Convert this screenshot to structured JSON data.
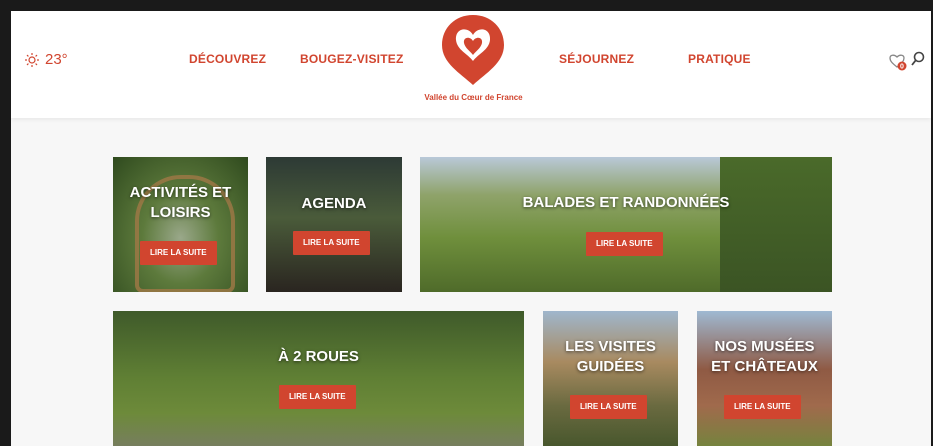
{
  "weather": {
    "temperature": "23°",
    "icon": "sun-icon"
  },
  "nav": {
    "left": [
      "DÉCOUVREZ",
      "BOUGEZ-VISITEZ"
    ],
    "right": [
      "SÉJOURNEZ",
      "PRATIQUE"
    ]
  },
  "brand": {
    "name": "Vallée du Cœur de France",
    "color": "#d1452f"
  },
  "header_icons": {
    "favorites_icon": "heart-icon",
    "favorites_count": "0",
    "search_icon": "search-icon"
  },
  "tiles": [
    {
      "title_line1": "ACTIVITÉS ET",
      "title_line2": "LOISIRS",
      "button": "LIRE LA SUITE"
    },
    {
      "title_line1": "AGENDA",
      "button": "LIRE LA SUITE"
    },
    {
      "title_line1": "BALADES ET RANDONNÉES",
      "button": "LIRE LA SUITE"
    },
    {
      "title_line1": "À 2 ROUES",
      "button": "LIRE LA SUITE"
    },
    {
      "title_line1": "LES VISITES",
      "title_line2": "GUIDÉES",
      "button": "LIRE LA SUITE"
    },
    {
      "title_line1": "NOS MUSÉES",
      "title_line2": "ET CHÂTEAUX",
      "button": "LIRE LA SUITE"
    }
  ]
}
